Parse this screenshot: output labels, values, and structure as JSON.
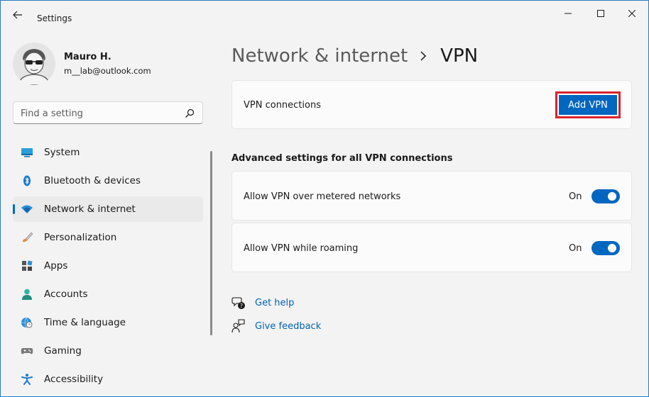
{
  "window": {
    "title": "Settings"
  },
  "profile": {
    "name": "Mauro H.",
    "email": "m__lab@outlook.com"
  },
  "search": {
    "placeholder": "Find a setting"
  },
  "nav": {
    "items": [
      {
        "label": "System",
        "icon": "system-icon",
        "active": false
      },
      {
        "label": "Bluetooth & devices",
        "icon": "bluetooth-icon",
        "active": false
      },
      {
        "label": "Network & internet",
        "icon": "wifi-icon",
        "active": true
      },
      {
        "label": "Personalization",
        "icon": "brush-icon",
        "active": false
      },
      {
        "label": "Apps",
        "icon": "apps-icon",
        "active": false
      },
      {
        "label": "Accounts",
        "icon": "person-icon",
        "active": false
      },
      {
        "label": "Time & language",
        "icon": "globe-clock-icon",
        "active": false
      },
      {
        "label": "Gaming",
        "icon": "gamepad-icon",
        "active": false
      },
      {
        "label": "Accessibility",
        "icon": "accessibility-icon",
        "active": false
      }
    ]
  },
  "breadcrumb": {
    "parent": "Network & internet",
    "current": "VPN"
  },
  "vpn_connections": {
    "label": "VPN connections",
    "button": "Add VPN"
  },
  "advanced": {
    "title": "Advanced settings for all VPN connections",
    "settings": [
      {
        "label": "Allow VPN over metered networks",
        "state": "On",
        "enabled": true
      },
      {
        "label": "Allow VPN while roaming",
        "state": "On",
        "enabled": true
      }
    ]
  },
  "links": {
    "help": "Get help",
    "feedback": "Give feedback"
  },
  "colors": {
    "accent": "#0067c0",
    "highlight_border": "#d6232e",
    "link": "#0062b3"
  }
}
